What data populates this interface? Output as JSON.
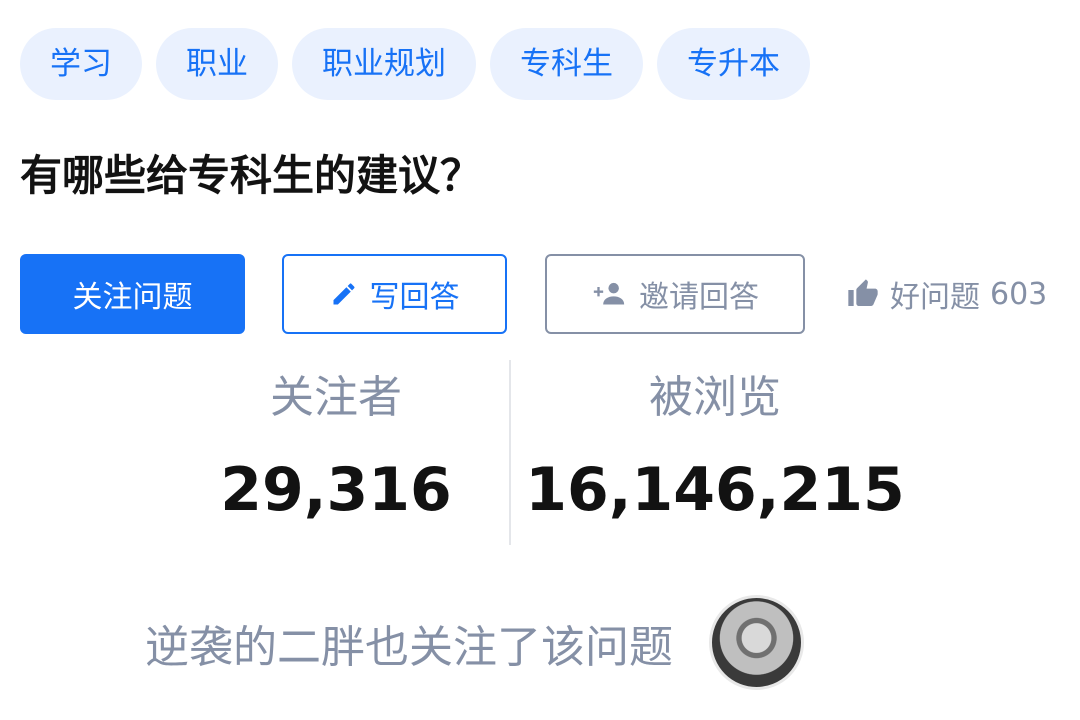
{
  "tags": [
    "学习",
    "职业",
    "职业规划",
    "专科生",
    "专升本"
  ],
  "question": {
    "title": "有哪些给专科生的建议？"
  },
  "actions": {
    "follow_label": "关注问题",
    "write_label": "写回答",
    "invite_label": "邀请回答",
    "good_label": "好问题",
    "good_count": "603"
  },
  "stats": {
    "followers_label": "关注者",
    "followers_value": "29,316",
    "views_label": "被浏览",
    "views_value": "16,146,215"
  },
  "footer": {
    "text": "逆袭的二胖也关注了该问题"
  },
  "colors": {
    "brand_blue": "#1772f6",
    "tag_bg": "#eaf1fe",
    "muted_gray": "#8590a6",
    "text_dark": "#121212"
  },
  "icons": {
    "write": "pencil-icon",
    "invite": "add-user-icon",
    "good": "thumbs-up-icon"
  }
}
